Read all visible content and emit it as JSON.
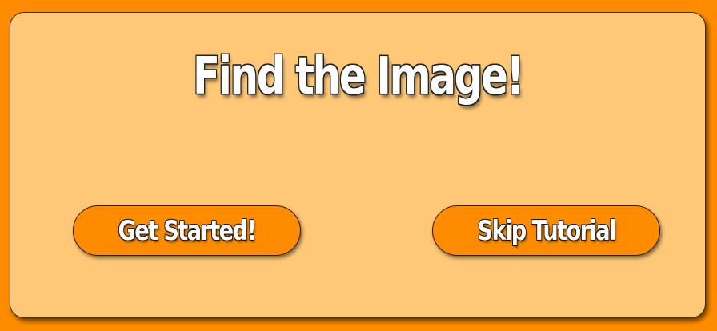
{
  "title": "Find the Image!",
  "buttons": {
    "get_started": "Get Started!",
    "skip_tutorial": "Skip Tutorial"
  },
  "colors": {
    "background": "#ff8c00",
    "panel": "#ffc877",
    "button": "#ff8c00",
    "text": "#ffffff"
  }
}
